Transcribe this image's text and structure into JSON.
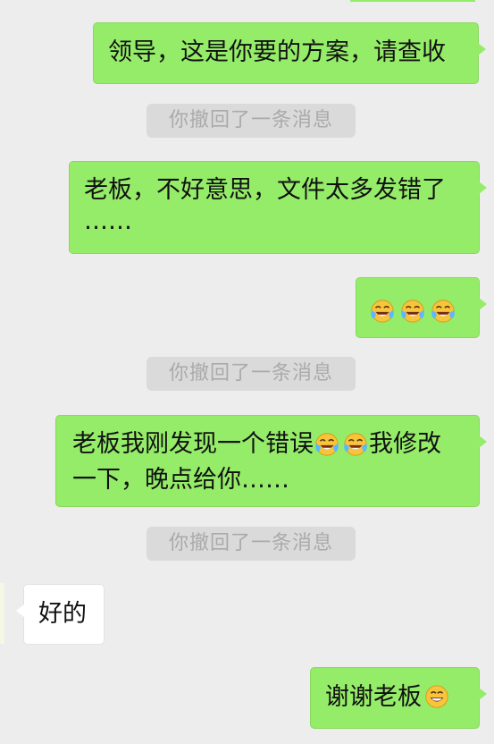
{
  "conversation": {
    "messages": [
      {
        "role": "sent",
        "text": "领导，这是你要的方案，请查收"
      },
      {
        "role": "system",
        "text": "你撤回了一条消息"
      },
      {
        "role": "sent",
        "line1": "老板，不好意思，文件太多发错了",
        "line2": "……"
      },
      {
        "role": "sent",
        "emoji": [
          "laugh-cry-emoji",
          "laugh-cry-emoji",
          "laugh-cry-emoji"
        ]
      },
      {
        "role": "system",
        "text": "你撤回了一条消息"
      },
      {
        "role": "sent",
        "line1_a": "老板我刚发现一个错误",
        "line1_b": "我修改",
        "line2": "一下，晚点给你……"
      },
      {
        "role": "system",
        "text": "你撤回了一条消息"
      },
      {
        "role": "received",
        "text": "好的"
      },
      {
        "role": "sent",
        "text": "谢谢老板",
        "emoji": "grin-emoji"
      }
    ]
  },
  "colors": {
    "background": "#ededed",
    "sent_bubble": "#95ec69",
    "received_bubble": "#ffffff",
    "system_notice": "#dadada",
    "system_text": "#aaaaaa"
  }
}
